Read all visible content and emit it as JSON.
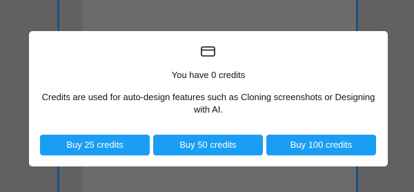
{
  "modal": {
    "icon": "credit-card-icon",
    "title": "You have 0 credits",
    "description": "Credits are used for auto-design features such as Cloning screenshots or Designing with AI.",
    "buttons": [
      {
        "label": "Buy 25 credits"
      },
      {
        "label": "Buy 50 credits"
      },
      {
        "label": "Buy 100 credits"
      }
    ]
  },
  "colors": {
    "button": "#199ef3",
    "overlay": "#616161",
    "edge": "#1e4f7c"
  }
}
